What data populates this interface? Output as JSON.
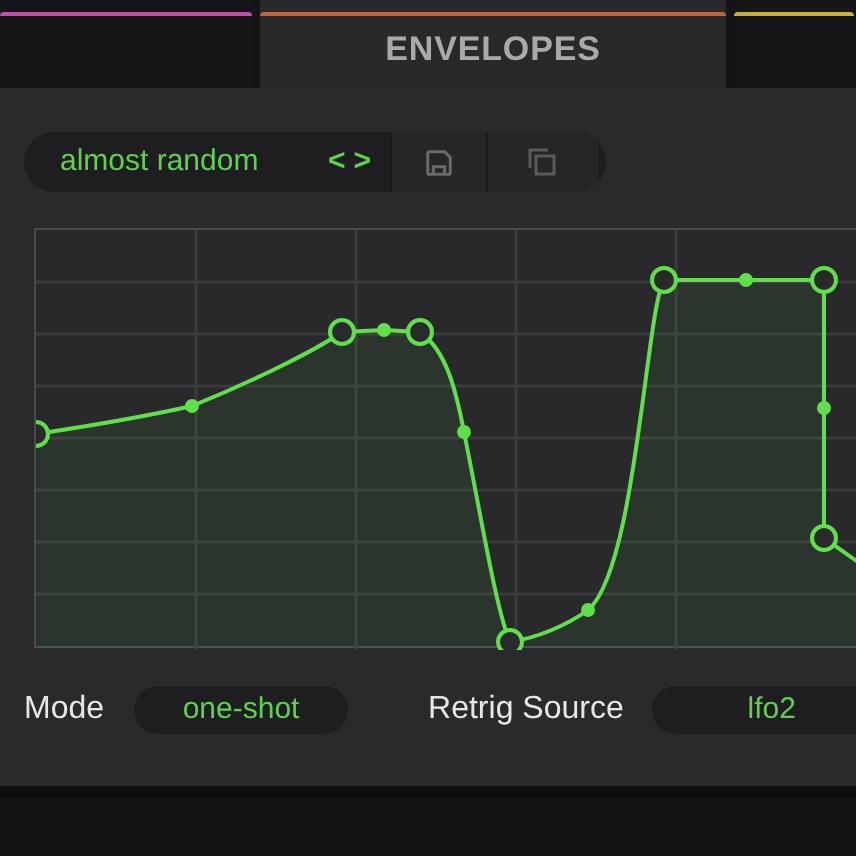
{
  "tabs": [
    {
      "color": "#c04fa8",
      "selected": false
    },
    {
      "label": "ENVELOPES",
      "color": "#c0643c",
      "selected": true
    },
    {
      "color": "#c8b040",
      "selected": false
    }
  ],
  "preset": {
    "name": "almost random",
    "prev": "<",
    "next": ">"
  },
  "settings": [
    {
      "label": "Mode",
      "value": "one-shot"
    },
    {
      "label": "Retrig Source",
      "value": "lfo2"
    }
  ]
}
